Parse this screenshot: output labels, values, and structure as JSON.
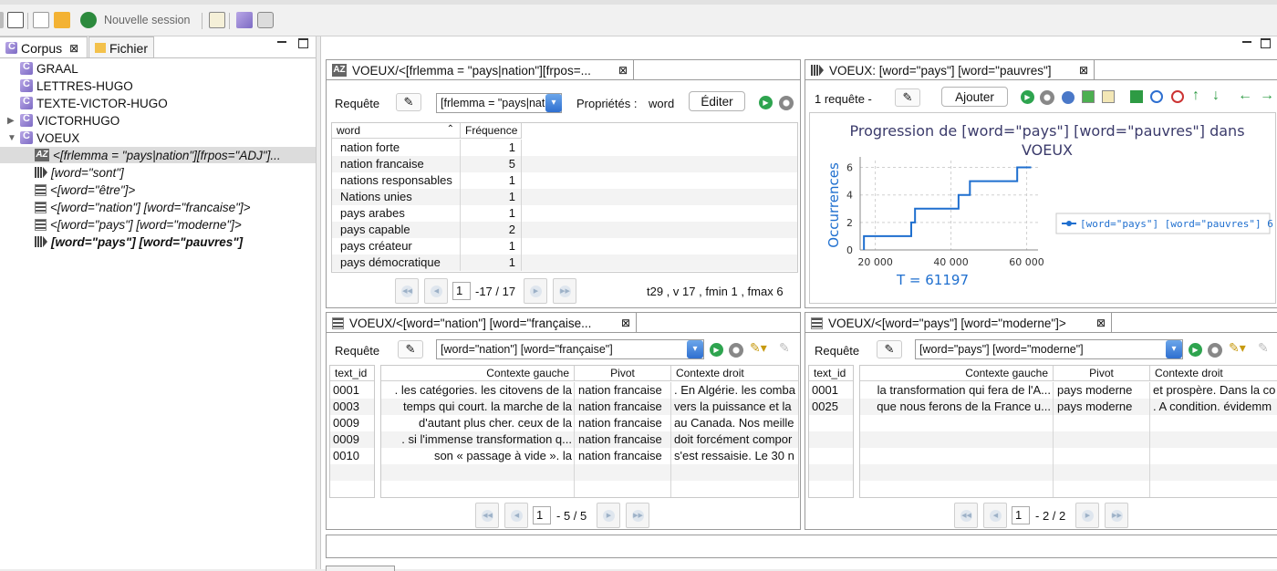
{
  "toolbar": {
    "new_session": "Nouvelle session"
  },
  "left_tabs": {
    "corpus": "Corpus",
    "fichier": "Fichier"
  },
  "tree": [
    {
      "label": "GRAAL",
      "icon": "corpus-icon"
    },
    {
      "label": "LETTRES-HUGO",
      "icon": "corpus-icon"
    },
    {
      "label": "TEXTE-VICTOR-HUGO",
      "icon": "corpus-icon"
    },
    {
      "label": "VICTORHUGO",
      "icon": "corpus-icon"
    },
    {
      "label": "VOEUX",
      "icon": "corpus-icon"
    },
    {
      "label": "<[frlemma = \"pays|nation\"][frpos=\"ADJ\"]...",
      "icon": "lexicon-icon"
    },
    {
      "label": "[word=\"sont\"]",
      "icon": "progression-icon"
    },
    {
      "label": "<[word=\"être\"]>",
      "icon": "concordance-icon"
    },
    {
      "label": "<[word=\"nation\"] [word=\"francaise\"]>",
      "icon": "concordance-icon"
    },
    {
      "label": "<[word=\"pays\"] [word=\"moderne\"]>",
      "icon": "concordance-icon"
    },
    {
      "label": "[word=\"pays\"] [word=\"pauvres\"]",
      "icon": "progression-icon"
    }
  ],
  "lexicon": {
    "tab_title": "VOEUX/<[frlemma = \"pays|nation\"][frpos=...",
    "query_label": "Requête",
    "query_value": "[frlemma = \"pays|nation\"][frpos=\"ADJ\"]",
    "props_label": "Propriétés :",
    "props_value": "word",
    "edit_button": "Éditer",
    "columns": [
      "word",
      "Fréquence"
    ],
    "rows": [
      [
        "nation forte",
        "1"
      ],
      [
        "nation francaise",
        "5"
      ],
      [
        "nations responsables",
        "1"
      ],
      [
        "Nations unies",
        "1"
      ],
      [
        "pays arabes",
        "1"
      ],
      [
        "pays capable",
        "2"
      ],
      [
        "pays créateur",
        "1"
      ],
      [
        "pays démocratique",
        "1"
      ]
    ],
    "page": "1",
    "page_total": "-17 / 17",
    "stats": "t29 , v 17 , fmin 1 , fmax 6"
  },
  "progression": {
    "tab_title": "VOEUX: [word=\"pays\"] [word=\"pauvres\"]",
    "queries_count": "1 requête -",
    "add_button": "Ajouter",
    "chart_data": {
      "type": "line",
      "title": "Progression de [word=\"pays\"] [word=\"pauvres\"] dans VOEUX",
      "ylabel": "Occurrences",
      "xlabel": "T = 61197",
      "xlim": [
        16000,
        63000
      ],
      "ylim": [
        0,
        6.5
      ],
      "xticks": [
        "20 000",
        "40 000",
        "60 000"
      ],
      "yticks": [
        "0",
        "2",
        "4",
        "6"
      ],
      "legend_position": "right",
      "series": [
        {
          "name": "[word=\"pays\"] [word=\"pauvres\"] 6",
          "steps": [
            [
              17000,
              1
            ],
            [
              29500,
              2
            ],
            [
              30500,
              3
            ],
            [
              42000,
              4
            ],
            [
              45000,
              5
            ],
            [
              57500,
              6
            ],
            [
              61197,
              6
            ]
          ]
        }
      ]
    }
  },
  "conc1": {
    "tab_title": "VOEUX/<[word=\"nation\"] [word=\"française...",
    "query_label": "Requête",
    "query_value": "[word=\"nation\"] [word=\"française\"]",
    "columns": [
      "text_id",
      "Contexte gauche",
      "Pivot",
      "Contexte droit"
    ],
    "rows": [
      [
        "0001",
        ". les catégories. les citovens de la",
        "nation francaise",
        ". En Algérie. les comba"
      ],
      [
        "0003",
        "temps qui court. la marche de la",
        "nation francaise",
        "vers la puissance et la"
      ],
      [
        "0009",
        "d'autant plus cher. ceux de la",
        "nation francaise",
        "au Canada. Nos meille"
      ],
      [
        "0009",
        ". si l'immense transformation q...",
        "nation francaise",
        "doit forcément compor"
      ],
      [
        "0010",
        "son « passage à vide ». la",
        "nation francaise",
        "s'est ressaisie. Le 30 n"
      ]
    ],
    "page": "1",
    "page_total": "- 5 / 5"
  },
  "conc2": {
    "tab_title": "VOEUX/<[word=\"pays\"] [word=\"moderne\"]>",
    "query_label": "Requête",
    "query_value": "[word=\"pays\"] [word=\"moderne\"]",
    "columns": [
      "text_id",
      "Contexte gauche",
      "Pivot",
      "Contexte droit"
    ],
    "rows": [
      [
        "0001",
        "la transformation qui fera de l'A...",
        "pays moderne",
        "et prospère. Dans la co"
      ],
      [
        "0025",
        "que nous ferons de la France u...",
        "pays moderne",
        ". A condition. évidemm"
      ]
    ],
    "page": "1",
    "page_total": "- 2 / 2"
  },
  "colors": {
    "accent": "#2f6fd0",
    "chart_line": "#1f6fcf",
    "chart_title": "#3b3b6b"
  }
}
